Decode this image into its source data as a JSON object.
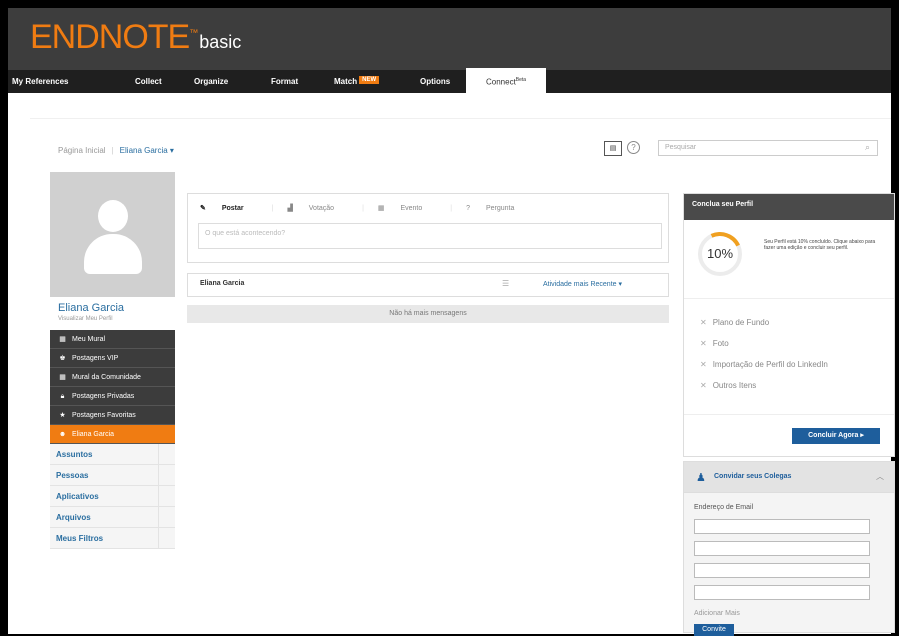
{
  "app": {
    "logo": "ENDNOTE",
    "logo_mark": "™",
    "edition": "basic"
  },
  "nav": {
    "items": [
      {
        "label": "My References"
      },
      {
        "label": "Collect"
      },
      {
        "label": "Organize"
      },
      {
        "label": "Format"
      },
      {
        "label": "Match",
        "badge": "NEW"
      },
      {
        "label": "Options"
      },
      {
        "label": "Connect",
        "badge": "Beta"
      }
    ]
  },
  "breadcrumb": {
    "home": "Página Inicial",
    "user": "Eliana Garcia ▾"
  },
  "search": {
    "placeholder": "Pesquisar"
  },
  "profile": {
    "name": "Eliana Garcia",
    "edit": "Visualizar Meu Perfil"
  },
  "sidenav": {
    "items": [
      {
        "label": "Meu Mural",
        "icon": "wall-icon"
      },
      {
        "label": "Postagens VIP",
        "icon": "vip-icon"
      },
      {
        "label": "Mural da Comunidade",
        "icon": "community-icon"
      },
      {
        "label": "Postagens Privadas",
        "icon": "lock-icon"
      },
      {
        "label": "Postagens Favoritas",
        "icon": "star-icon"
      },
      {
        "label": "Eliana Garcia",
        "icon": "user-icon"
      }
    ],
    "categories": [
      "Assuntos",
      "Pessoas",
      "Aplicativos",
      "Arquivos",
      "Meus Filtros"
    ]
  },
  "composer": {
    "tabs": [
      "Postar",
      "Votação",
      "Evento",
      "Pergunta"
    ],
    "placeholder": "O que está acontecendo?"
  },
  "feed": {
    "user": "Eliana Garcia",
    "filter": "Atividade mais Recente ▾",
    "empty": "Não há mais mensagens"
  },
  "profile_card": {
    "title": "Conclua seu Perfil",
    "percent": "10%",
    "percent_value": 0.1,
    "description": "Seu Perfil está 10% concluído. Clique abaixo para fazer uma edição e concluir seu perfil.",
    "tasks": [
      "Plano de Fundo",
      "Foto",
      "Importação de Perfil do LinkedIn",
      "Outros Itens"
    ],
    "button": "Concluir Agora ▸"
  },
  "invite": {
    "title": "Convidar seus Colegas",
    "email_label": "Endereço de Email",
    "add_more": "Adicionar Mais",
    "button": "Convite"
  },
  "colors": {
    "accent": "#f07c12",
    "link": "#2a6ea0",
    "button": "#1e5e9c",
    "header": "#3d3d3d"
  }
}
